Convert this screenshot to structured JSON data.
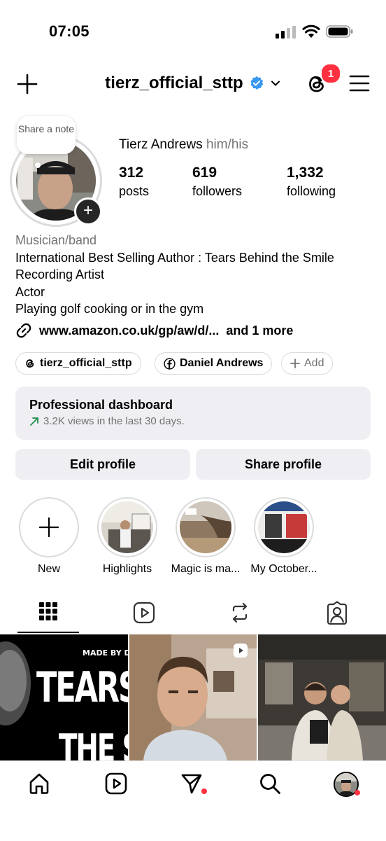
{
  "status_bar": {
    "time": "07:05"
  },
  "header": {
    "username": "tierz_official_sttp",
    "threads_badge": "1"
  },
  "profile": {
    "note_prompt": "Share a note",
    "full_name": "Tierz Andrews",
    "pronouns": "him/his",
    "stats": [
      {
        "value": "312",
        "label": "posts"
      },
      {
        "value": "619",
        "label": "followers"
      },
      {
        "value": "1,332",
        "label": "following"
      }
    ],
    "category": "Musician/band",
    "bio_lines": [
      "International Best Selling Author : Tears Behind the Smile",
      "Recording Artist",
      "Actor",
      "Playing golf cooking or in the gym"
    ],
    "link": "www.amazon.co.uk/gp/aw/d/...",
    "link_more": "and 1 more",
    "chips": [
      {
        "icon": "threads-icon",
        "label": "tierz_official_sttp"
      },
      {
        "icon": "facebook-icon",
        "label": "Daniel Andrews"
      },
      {
        "icon": "plus-icon",
        "label": "Add"
      }
    ]
  },
  "dashboard": {
    "title": "Professional dashboard",
    "subtitle": "3.2K views in the last 30 days."
  },
  "buttons": {
    "edit": "Edit profile",
    "share": "Share profile"
  },
  "highlights": [
    {
      "label": "New"
    },
    {
      "label": "Highlights"
    },
    {
      "label": "Magic is ma..."
    },
    {
      "label": "My October..."
    }
  ],
  "tabs": [
    "grid-icon",
    "reels-icon",
    "reposts-icon",
    "tagged-icon"
  ],
  "posts": [
    {
      "overlay_small": "MADE BY DAVID TE",
      "overlay_big_1": "TEARS B",
      "overlay_big_2": "THE SI"
    },
    {
      "type": "reel"
    },
    {
      "type": "photo"
    }
  ],
  "colors": {
    "accent_badge": "#ff3040",
    "verified": "#3897f0",
    "secondary_text": "#737373",
    "button_bg": "#efeff3"
  }
}
